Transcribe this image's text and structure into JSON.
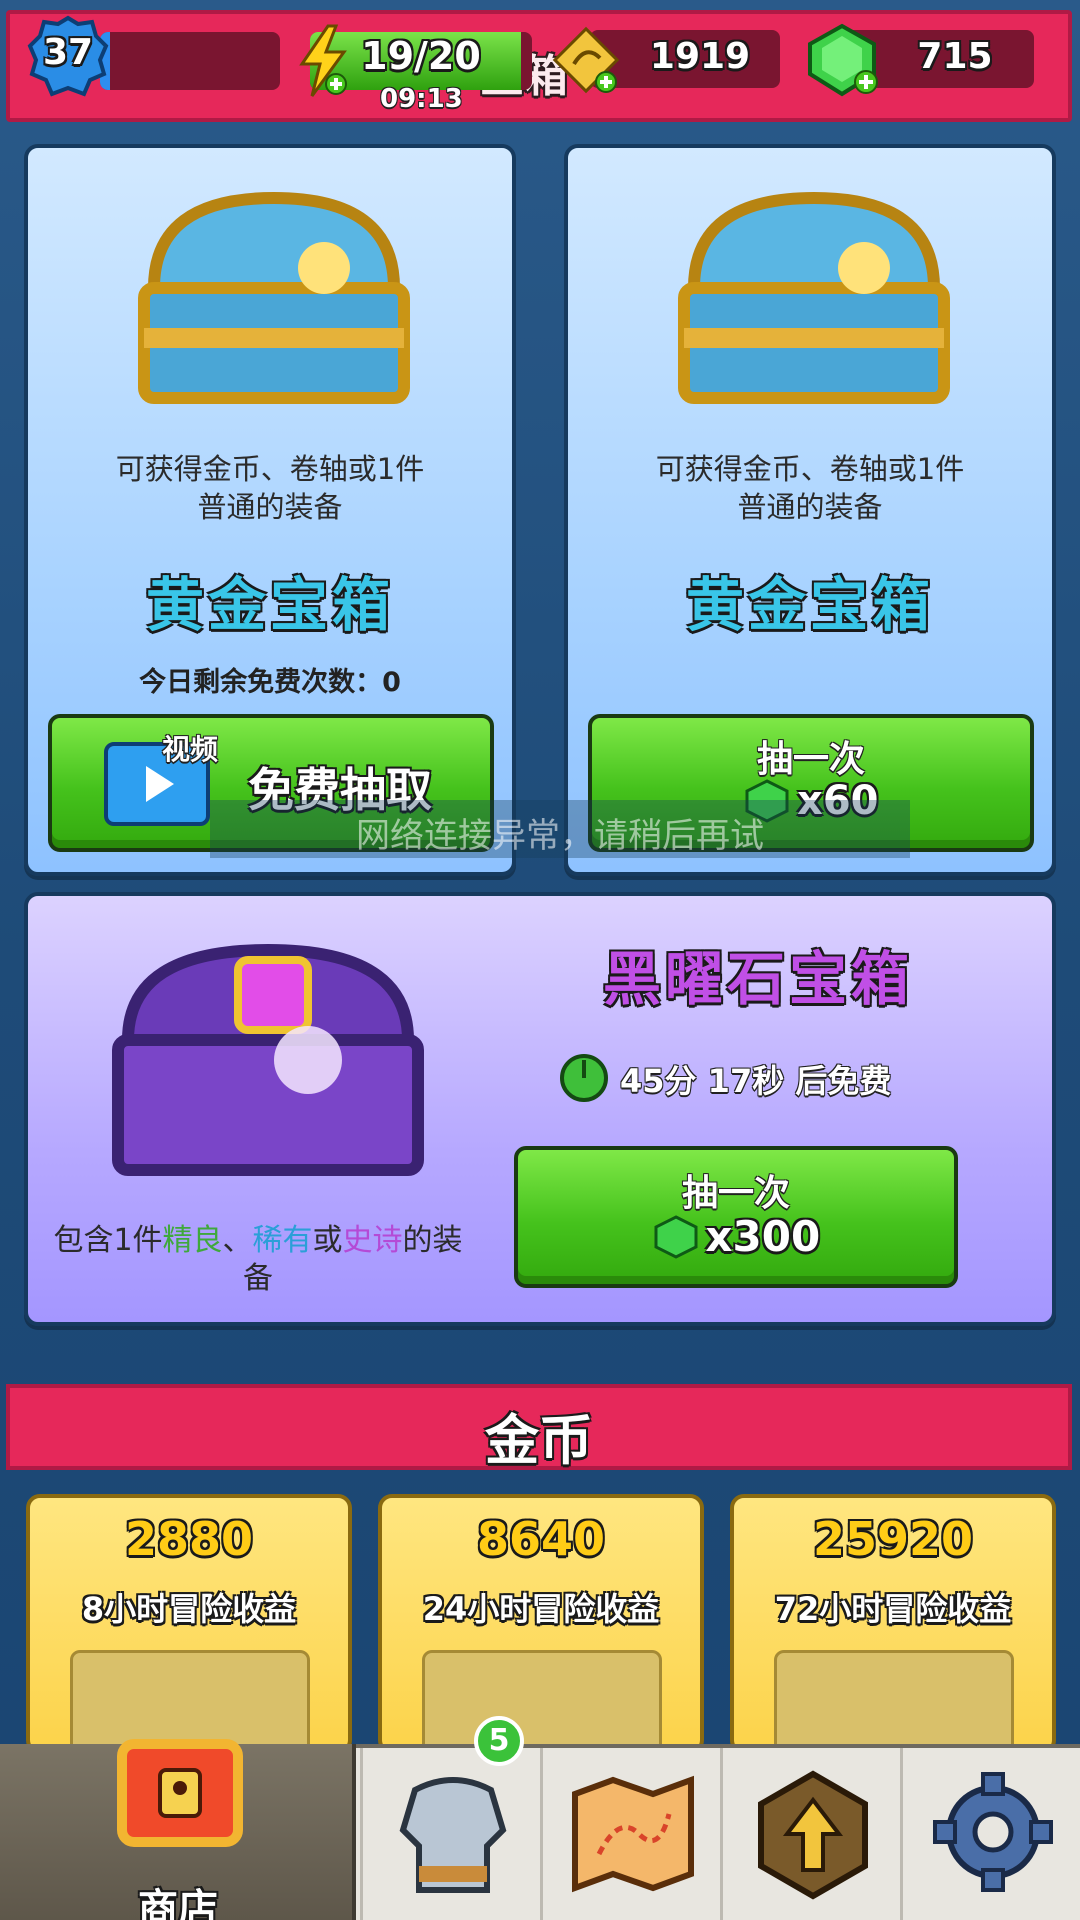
{
  "header": {
    "title": "宝箱",
    "level": "37",
    "energy": "19/20",
    "energy_fraction": 0.95,
    "energy_timer": "09:13",
    "scrolls": "1919",
    "gems": "715"
  },
  "gold_chest_free": {
    "description_line1": "可获得金币、卷轴或1件",
    "description_line2": "普通的装备",
    "name": "黄金宝箱",
    "free_left": "今日剩余免费次数：0",
    "video_tag": "视频",
    "button_label": "免费抽取"
  },
  "gold_chest_paid": {
    "description_line1": "可获得金币、卷轴或1件",
    "description_line2": "普通的装备",
    "name": "黄金宝箱",
    "button_line1": "抽一次",
    "button_cost": "x60"
  },
  "toast": "网络连接异常，请稍后再试",
  "obsidian_chest": {
    "name": "黑曜石宝箱",
    "timer": "45分 17秒 后免费",
    "desc_1": "包含1件",
    "desc_fine": "精良",
    "desc_sep": "、",
    "desc_rare": "稀有",
    "desc_or": "或",
    "desc_epic": "史诗",
    "desc_end": "的装",
    "desc_line2": "备",
    "button_line1": "抽一次",
    "button_cost": "x300"
  },
  "gold_section": {
    "title": "金币",
    "packs": [
      {
        "amount": "2880",
        "label": "8小时冒险收益"
      },
      {
        "amount": "8640",
        "label": "24小时冒险收益"
      },
      {
        "amount": "25920",
        "label": "72小时冒险收益"
      }
    ]
  },
  "nav": {
    "shop_label": "商店",
    "equipment_badge": "5"
  },
  "colors": {
    "banner": "#e6285a",
    "gold_name": "#39c6e8",
    "obsidian_name": "#c04fe6",
    "fine": "#3fa83c",
    "rare": "#2b9fd8",
    "epic": "#b44ad6"
  }
}
